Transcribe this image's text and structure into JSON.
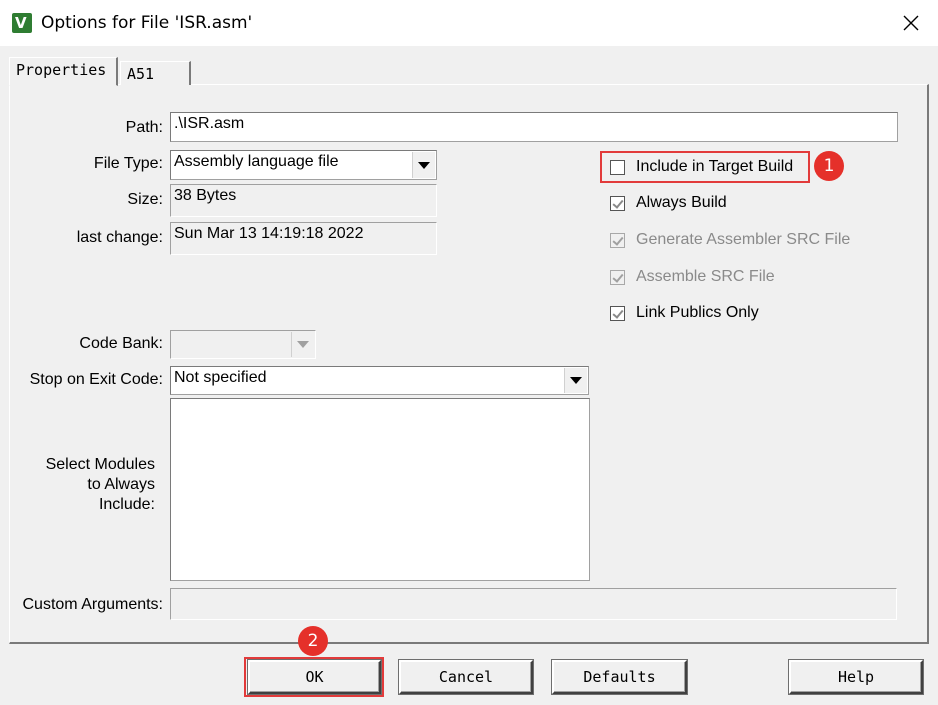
{
  "window": {
    "title": "Options for File 'ISR.asm'",
    "app_icon_glyph": "V",
    "icons": {
      "app": "keil-uvision-icon",
      "close": "close-icon"
    }
  },
  "tabs": [
    {
      "label": "Properties",
      "active": true
    },
    {
      "label": "A51",
      "active": false
    }
  ],
  "fields": {
    "path_label": "Path:",
    "path_value": ".\\ISR.asm",
    "file_type_label": "File Type:",
    "file_type_value": "Assembly language file",
    "size_label": "Size:",
    "size_value": "38 Bytes",
    "last_change_label": "last change:",
    "last_change_value": "Sun Mar 13 14:19:18 2022",
    "code_bank_label": "Code Bank:",
    "code_bank_value": "",
    "stop_on_exit_label": "Stop on Exit Code:",
    "stop_on_exit_value": "Not specified",
    "select_modules_label_1": "Select Modules",
    "select_modules_label_2": "to Always",
    "select_modules_label_3": "Include:",
    "custom_args_label": "Custom Arguments:",
    "custom_args_value": ""
  },
  "checkboxes": [
    {
      "label": "Include in Target Build",
      "checked": false,
      "enabled": true
    },
    {
      "label": "Always Build",
      "checked": true,
      "enabled": true
    },
    {
      "label": "Generate Assembler SRC File",
      "checked": true,
      "enabled": false
    },
    {
      "label": "Assemble SRC File",
      "checked": true,
      "enabled": false
    },
    {
      "label": "Link Publics Only",
      "checked": true,
      "enabled": true
    }
  ],
  "annotations": {
    "badge_1": "1",
    "badge_2": "2",
    "highlight_color": "#e23b3b"
  },
  "buttons": {
    "ok": "OK",
    "cancel": "Cancel",
    "defaults": "Defaults",
    "help": "Help"
  }
}
